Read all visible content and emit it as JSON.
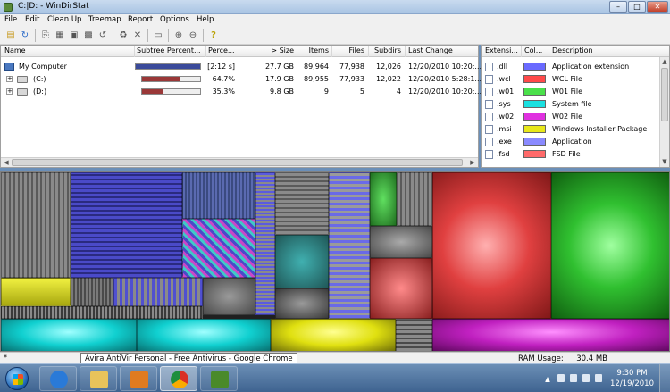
{
  "window": {
    "title": "C:|D: - WinDirStat",
    "buttons": {
      "minimize": "–",
      "maximize": "□",
      "close": "✕"
    }
  },
  "menu": [
    "File",
    "Edit",
    "Clean Up",
    "Treemap",
    "Report",
    "Options",
    "Help"
  ],
  "tree": {
    "headers": [
      "Name",
      "Subtree Percent...",
      "Perce...",
      "> Size",
      "Items",
      "Files",
      "Subdirs",
      "Last Change"
    ],
    "rows": [
      {
        "name": "My Computer",
        "percent": "[2:12 s]",
        "size": "27.7 GB",
        "items": "89,964",
        "files": "77,938",
        "subdirs": "12,026",
        "last_change": "12/20/2010  10:20:...",
        "bar_fraction": 1.0,
        "bar_color": "#3a4a9a"
      },
      {
        "name": "(C:)",
        "percent": "64.7%",
        "size": "17.9 GB",
        "items": "89,955",
        "files": "77,933",
        "subdirs": "12,022",
        "last_change": "12/20/2010  5:28:1...",
        "bar_fraction": 0.647,
        "bar_color": "#9a3838"
      },
      {
        "name": "(D:)",
        "percent": "35.3%",
        "size": "9.8 GB",
        "items": "9",
        "files": "5",
        "subdirs": "4",
        "last_change": "12/20/2010  10:20:...",
        "bar_fraction": 0.353,
        "bar_color": "#9a3838"
      }
    ],
    "expand_glyph": "+"
  },
  "extensions": {
    "headers": [
      "Extensi...",
      "Col...",
      "Description"
    ],
    "rows": [
      {
        "ext": ".dll",
        "color": "#6a6aff",
        "desc": "Application extension"
      },
      {
        "ext": ".wcl",
        "color": "#ff4a4a",
        "desc": "WCL File"
      },
      {
        "ext": ".w01",
        "color": "#4ae04a",
        "desc": "W01 File"
      },
      {
        "ext": ".sys",
        "color": "#1ae0e0",
        "desc": "System file"
      },
      {
        "ext": ".w02",
        "color": "#e030e0",
        "desc": "W02 File"
      },
      {
        "ext": ".msi",
        "color": "#e8e81a",
        "desc": "Windows Installer Package"
      },
      {
        "ext": ".exe",
        "color": "#8a8aff",
        "desc": "Application"
      },
      {
        "ext": ".fsd",
        "color": "#ff6a6a",
        "desc": "FSD File"
      }
    ]
  },
  "status": {
    "ram_label": "RAM Usage:",
    "ram_value": "30.4 MB",
    "star": "*"
  },
  "tooltip": "Avira AntiVir Personal - Free Antivirus - Google Chrome",
  "taskbar": {
    "apps": [
      {
        "name": "internet-explorer",
        "color": "#2a7ad8"
      },
      {
        "name": "file-explorer",
        "color": "#e9c35a"
      },
      {
        "name": "media-player",
        "color": "#e07b20"
      },
      {
        "name": "google-chrome",
        "color": "#d8d8d8"
      },
      {
        "name": "windirstat",
        "color": "#4a8a2a"
      }
    ],
    "clock_time": "9:30 PM",
    "clock_date": "12/19/2010"
  }
}
